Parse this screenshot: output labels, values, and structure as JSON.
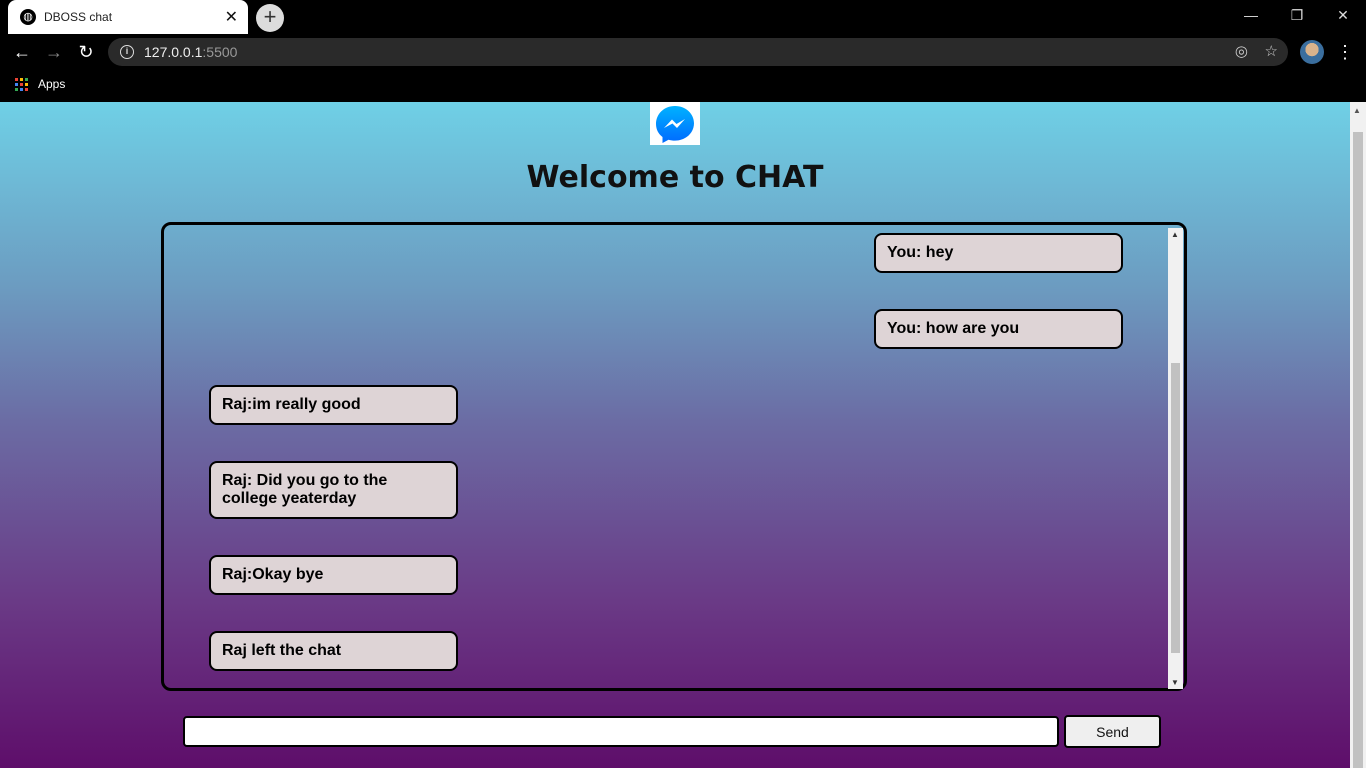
{
  "browser": {
    "tab_title": "DBOSS chat",
    "tab_close": "✕",
    "new_tab": "+",
    "url_host": "127.0.0.1",
    "url_port": ":5500",
    "bookmarks_apps_label": "Apps",
    "window_controls": {
      "minimize": "—",
      "maximize": "❐",
      "close": "✕"
    }
  },
  "page": {
    "title": "Welcome to CHAT",
    "logo_icon": "messenger-logo"
  },
  "chat": {
    "messages": [
      {
        "side": "right",
        "text": "You: hey"
      },
      {
        "side": "right",
        "text": "You: how are you"
      },
      {
        "side": "left",
        "text": "Raj:im really good"
      },
      {
        "side": "left",
        "text": "Raj: Did you go to the college yeaterday"
      },
      {
        "side": "left",
        "text": "Raj:Okay bye"
      },
      {
        "side": "left",
        "text": "Raj left the chat"
      }
    ]
  },
  "composer": {
    "input_value": "",
    "send_label": "Send"
  },
  "colors": {
    "bubble": "#ded4d6",
    "gradient_top": "#6fd0e6",
    "gradient_bottom": "#5e0e6a"
  }
}
